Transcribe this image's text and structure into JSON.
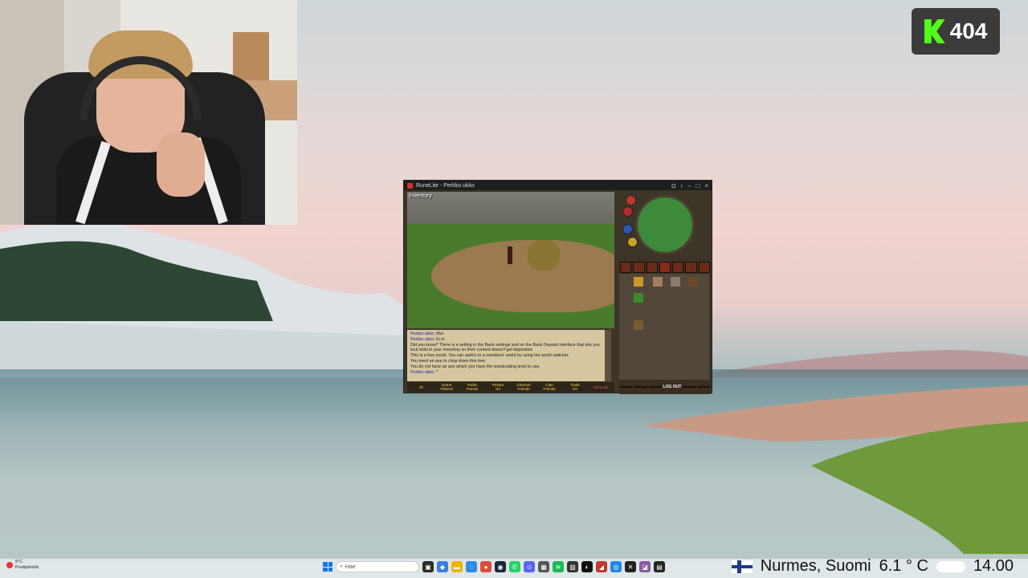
{
  "overlay": {
    "viewer_count": "404"
  },
  "runelite": {
    "window_title": "RuneLite - Perkko ukko",
    "game_label": "Inventory",
    "chat_lines": [
      {
        "name": "Perkko ukko:",
        "text": "Mut"
      },
      {
        "name": "Perkko ukko:",
        "text": "Ei ol"
      },
      {
        "name": "",
        "text": "Did you know? There is a setting in the Bank settings and on the Bank Deposit interface that lets you lock slots in your inventory so their content doesn't get deposited."
      },
      {
        "name": "",
        "text": "This is a free world. You can switch to a members' world by using the world switcher."
      },
      {
        "name": "",
        "text": "You need an axe to chop down this tree."
      },
      {
        "name": "",
        "text": "You do not have an axe which you have the woodcutting level to use."
      },
      {
        "name": "Perkko ukko:",
        "text": "*"
      }
    ],
    "chat_tabs": [
      {
        "top": "All",
        "bottom": ""
      },
      {
        "top": "Game",
        "bottom": "Filtered"
      },
      {
        "top": "Public",
        "bottom": "Friends"
      },
      {
        "top": "Private",
        "bottom": "On"
      },
      {
        "top": "Channel",
        "bottom": "Friends"
      },
      {
        "top": "Clan",
        "bottom": "Friends"
      },
      {
        "top": "Trade",
        "bottom": "On"
      }
    ],
    "report_timer": "00:01:46",
    "logout_label": "LOG OUT"
  },
  "taskbar": {
    "weather_temp": "5°C",
    "weather_desc": "Puolipilvistä",
    "search_placeholder": "Hae",
    "location": "Nurmes, Suomi",
    "temperature": "6.1 ° C",
    "time": "14.00"
  }
}
